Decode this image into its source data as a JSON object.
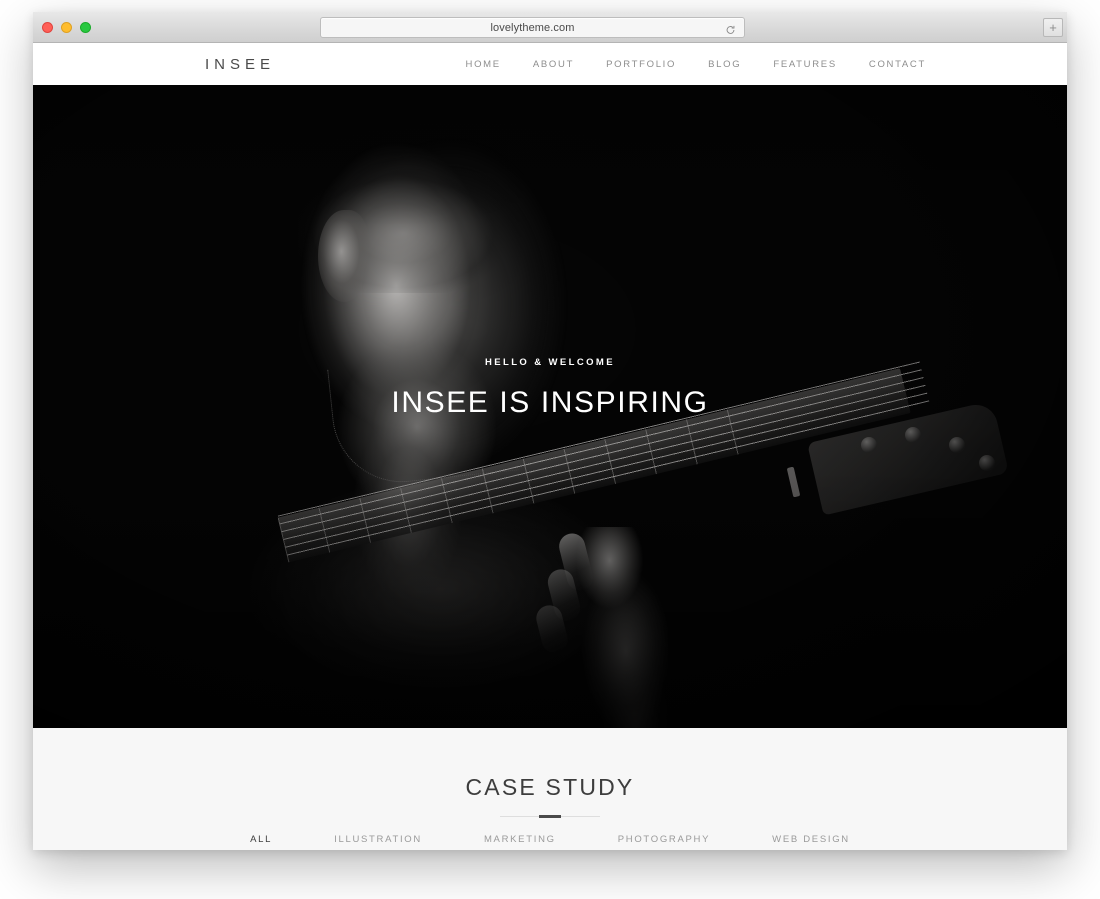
{
  "browser": {
    "url": "lovelytheme.com",
    "reload_icon": "reload-icon",
    "new_tab_label": "+",
    "traffic_lights": [
      "close",
      "minimize",
      "maximize"
    ]
  },
  "site": {
    "brand": "INSEE",
    "nav": [
      {
        "label": "HOME"
      },
      {
        "label": "ABOUT"
      },
      {
        "label": "PORTFOLIO"
      },
      {
        "label": "BLOG"
      },
      {
        "label": "FEATURES"
      },
      {
        "label": "CONTACT"
      }
    ],
    "hero": {
      "eyebrow": "HELLO & WELCOME",
      "title": "INSEE IS INSPIRING",
      "background_description": "black-and-white photo of a man playing an acoustic guitar in low key lighting"
    },
    "case_study": {
      "title": "CASE STUDY",
      "filters": [
        {
          "label": "ALL",
          "active": true
        },
        {
          "label": "ILLUSTRATION",
          "active": false
        },
        {
          "label": "MARKETING",
          "active": false
        },
        {
          "label": "PHOTOGRAPHY",
          "active": false
        },
        {
          "label": "WEB DESIGN",
          "active": false
        }
      ]
    }
  },
  "colors": {
    "hero_background": "#000000",
    "nav_background": "#ffffff",
    "section_background": "#f7f7f7",
    "text_muted": "#8e8e8e",
    "text_dark": "#3d3d3d",
    "accent_divider": "#4a4a4a"
  }
}
